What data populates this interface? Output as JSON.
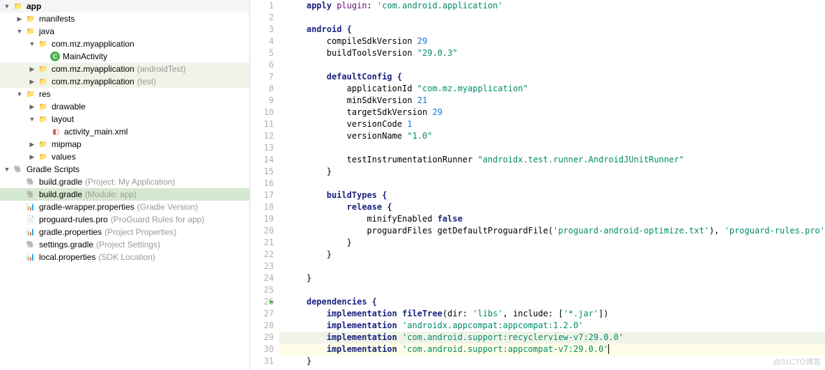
{
  "tree": {
    "app": "app",
    "manifests": "manifests",
    "java": "java",
    "pkg1": "com.mz.myapplication",
    "mainActivity": "MainActivity",
    "pkg2": "com.mz.myapplication",
    "pkg2hint": "(androidTest)",
    "pkg3": "com.mz.myapplication",
    "pkg3hint": "(test)",
    "res": "res",
    "drawable": "drawable",
    "layout": "layout",
    "activityMain": "activity_main.xml",
    "mipmap": "mipmap",
    "values": "values",
    "gradleScripts": "Gradle Scripts",
    "bg1": "build.gradle",
    "bg1hint": "(Project: My Application)",
    "bg2": "build.gradle",
    "bg2hint": "(Module: app)",
    "gwp": "gradle-wrapper.properties",
    "gwphint": "(Gradle Version)",
    "prg": "proguard-rules.pro",
    "prghint": "(ProGuard Rules for app)",
    "gp": "gradle.properties",
    "gphint": "(Project Properties)",
    "sg": "settings.gradle",
    "sghint": "(Project Settings)",
    "lp": "local.properties",
    "lphint": "(SDK Location)"
  },
  "code": {
    "l1a": "apply",
    "l1b": "plugin",
    "l1c": ": ",
    "l1d": "'com.android.application'",
    "l3": "android {",
    "l4a": "compileSdkVersion ",
    "l4b": "29",
    "l5a": "buildToolsVersion ",
    "l5b": "\"29.0.3\"",
    "l7": "defaultConfig {",
    "l8a": "applicationId ",
    "l8b": "\"com.mz.myapplication\"",
    "l9a": "minSdkVersion ",
    "l9b": "21",
    "l10a": "targetSdkVersion ",
    "l10b": "29",
    "l11a": "versionCode ",
    "l11b": "1",
    "l12a": "versionName ",
    "l12b": "\"1.0\"",
    "l14a": "testInstrumentationRunner ",
    "l14b": "\"androidx.test.runner.AndroidJUnitRunner\"",
    "l15": "}",
    "l17": "buildTypes {",
    "l18": "release {",
    "l19a": "minifyEnabled ",
    "l19b": "false",
    "l20a": "proguardFiles getDefaultProguardFile(",
    "l20b": "'proguard-android-optimize.txt'",
    "l20c": "), ",
    "l20d": "'proguard-rules.pro'",
    "l21": "}",
    "l22": "}",
    "l24": "}",
    "l26": "dependencies {",
    "l27a": "implementation ",
    "l27b": "fileTree",
    "l27c": "(dir: ",
    "l27d": "'libs'",
    "l27e": ", include: [",
    "l27f": "'*.jar'",
    "l27g": "])",
    "l28a": "implementation ",
    "l28b": "'androidx.appcompat:appcompat:1.2.0'",
    "l29a": "implementation ",
    "l29b": "'com.android.support:recyclerview-v7:29.0.0'",
    "l30a": "implementation ",
    "l30b": "'com.android.support:appcompat-v7:29.0.0'",
    "l31": "}"
  },
  "watermark": "@51CTO博客"
}
